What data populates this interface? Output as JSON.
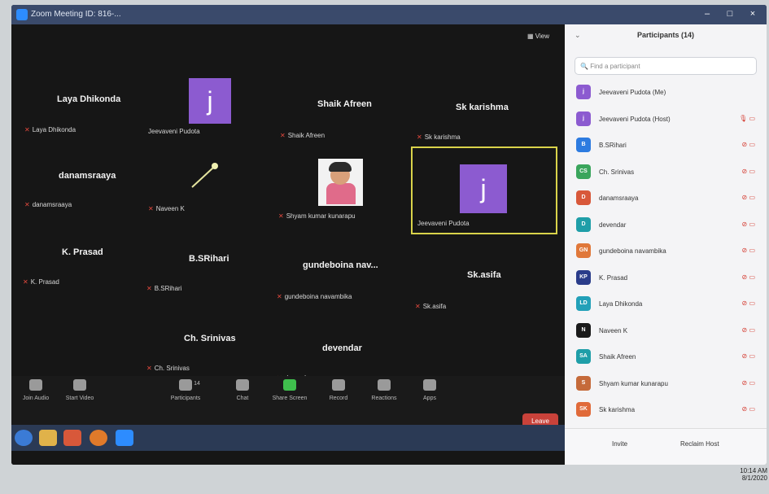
{
  "window": {
    "title": "Zoom Meeting ID: 816-...",
    "controls": [
      "–",
      "□",
      "×"
    ]
  },
  "video": {
    "view_label": "View",
    "tiles": [
      {
        "name": "Laya Dhikonda",
        "label": "Laya Dhikonda"
      },
      {
        "name": "",
        "label": "Jeevaveni Pudota"
      },
      {
        "name": "Shaik Afreen",
        "label": "Shaik Afreen"
      },
      {
        "name": "Sk karishma",
        "label": "Sk karishma"
      },
      {
        "name": "danamsraaya",
        "label": "danamsraaya"
      },
      {
        "name": "",
        "label": "Naveen K"
      },
      {
        "name": "",
        "label": "Shyam kumar kunarapu"
      },
      {
        "name": "",
        "label": "Jeevaveni Pudota"
      },
      {
        "name": "K. Prasad",
        "label": "K. Prasad"
      },
      {
        "name": "B.SRihari",
        "label": "B.SRihari"
      },
      {
        "name": "gundeboina nav...",
        "label": "gundeboina navambika"
      },
      {
        "name": "Sk.asifa",
        "label": "Sk.asifa"
      },
      {
        "name": "Ch. Srinivas",
        "label": "Ch. Srinivas"
      },
      {
        "name": "devendar",
        "label": "devendar"
      }
    ],
    "avatar_letter": "j"
  },
  "toolbar": {
    "join_audio": "Join Audio",
    "start_video": "Start Video",
    "participants": "Participants",
    "participants_count": "14",
    "chat": "Chat",
    "share_screen": "Share Screen",
    "record": "Record",
    "reactions": "Reactions",
    "apps": "Apps",
    "leave": "Leave"
  },
  "panel": {
    "title": "Participants (14)",
    "search_placeholder": "Find a participant",
    "participants": [
      {
        "initials": "j",
        "name": "Jeevaveni Pudota (Me)",
        "color": "#8c5bd0"
      },
      {
        "initials": "j",
        "name": "Jeevaveni Pudota (Host)",
        "color": "#8c5bd0"
      },
      {
        "initials": "B",
        "name": "B.SRihari",
        "color": "#2d7be0"
      },
      {
        "initials": "CS",
        "name": "Ch. Srinivas",
        "color": "#3aa55c"
      },
      {
        "initials": "D",
        "name": "danamsraaya",
        "color": "#d8583a"
      },
      {
        "initials": "D",
        "name": "devendar",
        "color": "#1f9ea8"
      },
      {
        "initials": "GN",
        "name": "gundeboina navambika",
        "color": "#e0783a"
      },
      {
        "initials": "KP",
        "name": "K. Prasad",
        "color": "#2a3c8a"
      },
      {
        "initials": "LD",
        "name": "Laya Dhikonda",
        "color": "#22a0b8"
      },
      {
        "initials": "N",
        "name": "Naveen K",
        "color": "#1a1a1a"
      },
      {
        "initials": "SA",
        "name": "Shaik Afreen",
        "color": "#1f9ea8"
      },
      {
        "initials": "S",
        "name": "Shyam kumar kunarapu",
        "color": "#c56a3a"
      },
      {
        "initials": "SK",
        "name": "Sk karishma",
        "color": "#e06a3a"
      }
    ],
    "invite": "Invite",
    "reclaim_host": "Reclaim Host"
  },
  "clock": {
    "time": "10:14 AM",
    "date": "8/1/2020"
  }
}
